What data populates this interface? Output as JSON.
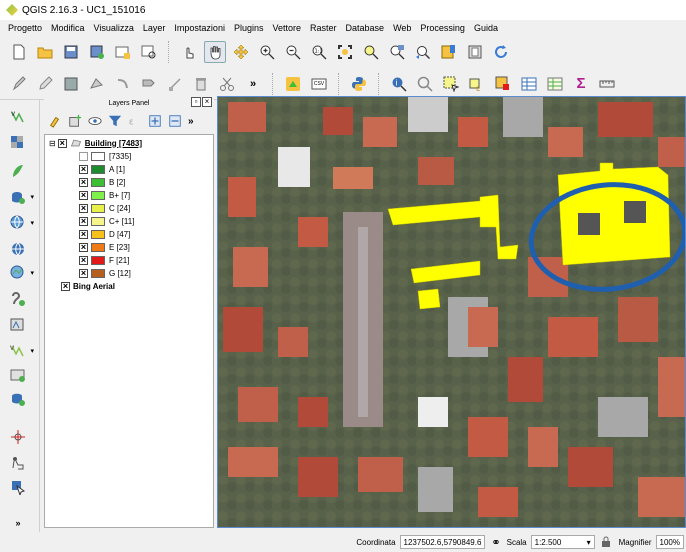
{
  "window": {
    "title": "QGIS 2.16.3 - UC1_151016"
  },
  "menu": [
    "Progetto",
    "Modifica",
    "Visualizza",
    "Layer",
    "Impostazioni",
    "Plugins",
    "Vettore",
    "Raster",
    "Database",
    "Web",
    "Processing",
    "Guida"
  ],
  "toolbar2": {
    "csv_label": "CSV",
    "sigma_label": "Σ"
  },
  "layers_panel": {
    "title": "Layers Panel",
    "layers": [
      {
        "name": "Building [7483]",
        "checked": true
      },
      {
        "name": "Bing Aerial",
        "checked": true
      }
    ],
    "legend": [
      {
        "label": "[7335]",
        "checked": false,
        "color": "#ffffff"
      },
      {
        "label": "A [1]",
        "checked": true,
        "color": "#1e8b2e"
      },
      {
        "label": "B [2]",
        "checked": true,
        "color": "#3cbf35"
      },
      {
        "label": "B+ [7]",
        "checked": true,
        "color": "#7ff04a"
      },
      {
        "label": "C [24]",
        "checked": true,
        "color": "#e8f04a"
      },
      {
        "label": "C+ [11]",
        "checked": true,
        "color": "#f5f58a"
      },
      {
        "label": "D [47]",
        "checked": true,
        "color": "#f6c21a"
      },
      {
        "label": "E [23]",
        "checked": true,
        "color": "#f07a16"
      },
      {
        "label": "F [21]",
        "checked": true,
        "color": "#e21a1a"
      },
      {
        "label": "G [12]",
        "checked": true,
        "color": "#b5601d"
      }
    ]
  },
  "statusbar": {
    "coord_label": "Coordinata",
    "coord_value": "1237502.6,5790849.6",
    "scale_label": "Scala",
    "scale_value": "1:2.500",
    "magnifier_label": "Magnifier",
    "magnifier_value": "100%"
  },
  "colors": {
    "highlight_ring": "#1f5fb0",
    "building_fill": "#ffff00",
    "accent": "#5b8ccf"
  }
}
